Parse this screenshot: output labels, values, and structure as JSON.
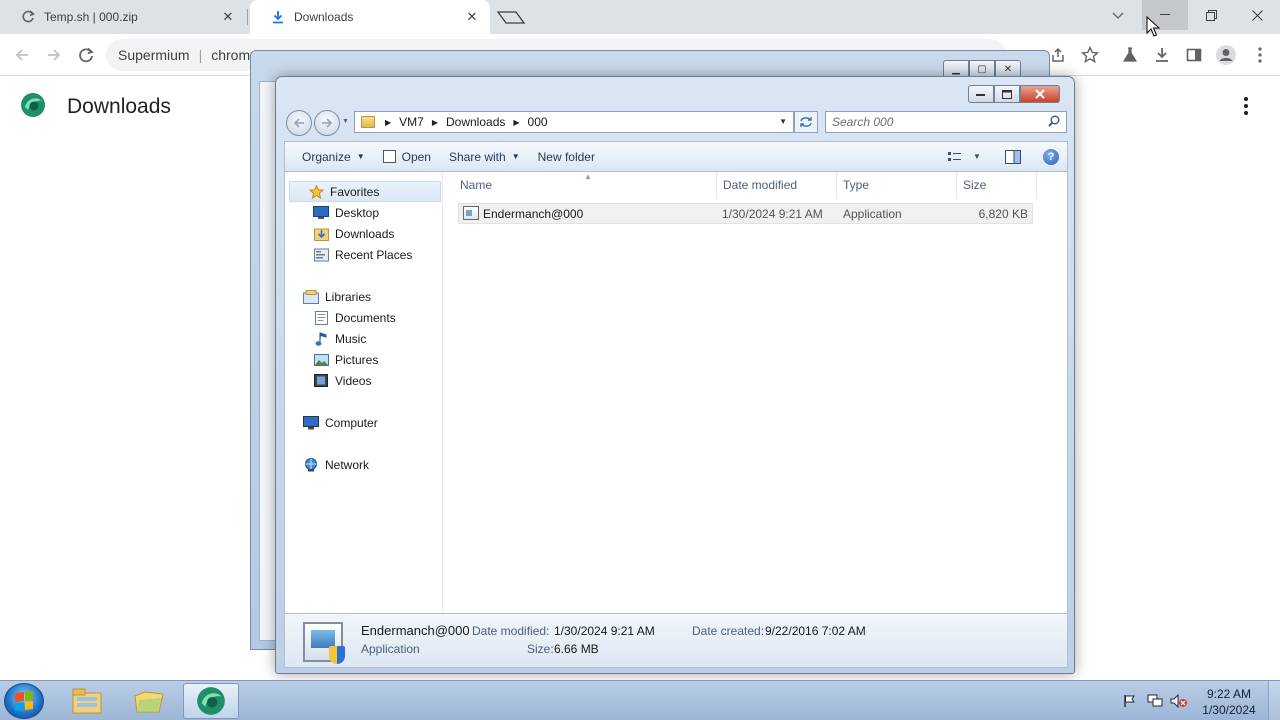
{
  "browser": {
    "tabs": [
      {
        "title": "Temp.sh | 000.zip",
        "icon": "reload-icon"
      },
      {
        "title": "Downloads",
        "icon": "download-icon"
      }
    ],
    "omnibox": {
      "site": "Supermium",
      "separator": "|",
      "url": "chrome"
    },
    "page_title": "Downloads"
  },
  "explorer": {
    "breadcrumb": [
      "VM7",
      "Downloads",
      "000"
    ],
    "search_placeholder": "Search 000",
    "commands": {
      "organize": "Organize",
      "open": "Open",
      "share_with": "Share with",
      "new_folder": "New folder"
    },
    "nav": {
      "favorites": "Favorites",
      "favorites_items": [
        "Desktop",
        "Downloads",
        "Recent Places"
      ],
      "libraries": "Libraries",
      "libraries_items": [
        "Documents",
        "Music",
        "Pictures",
        "Videos"
      ],
      "computer": "Computer",
      "network": "Network"
    },
    "columns": [
      "Name",
      "Date modified",
      "Type",
      "Size"
    ],
    "files": [
      {
        "name": "Endermanch@000",
        "date_modified": "1/30/2024 9:21 AM",
        "type": "Application",
        "size": "6,820 KB"
      }
    ],
    "details": {
      "name": "Endermanch@000",
      "type": "Application",
      "date_modified_label": "Date modified:",
      "date_modified": "1/30/2024 9:21 AM",
      "date_created_label": "Date created:",
      "date_created": "9/22/2016 7:02 AM",
      "size_label": "Size:",
      "size": "6.66 MB"
    }
  },
  "taskbar": {
    "time": "9:22 AM",
    "date": "1/30/2024"
  },
  "colors": {
    "chrome_tabbar": "#dee1e6",
    "explorer_frame": "#c5d6eb",
    "taskbar": "#9db6d6",
    "close_red": "#c7432a"
  }
}
